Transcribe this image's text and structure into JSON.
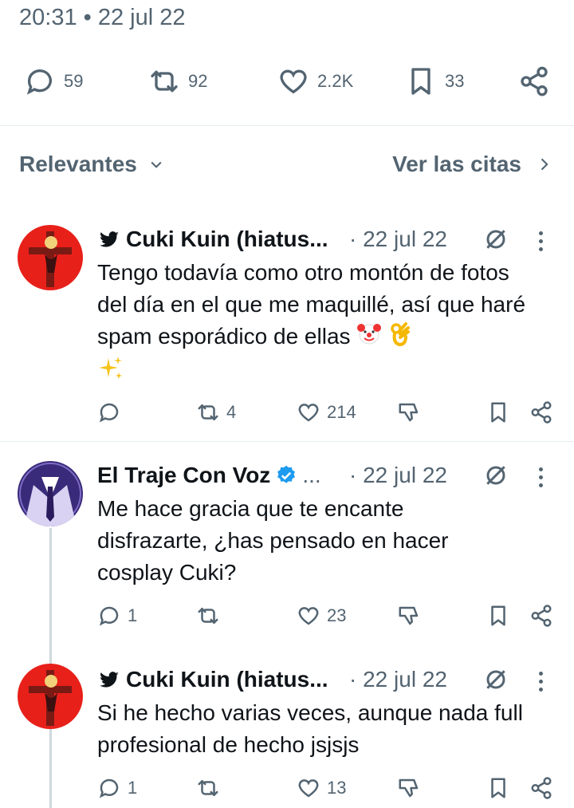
{
  "header": {
    "timestamp": "20:31 • 22 jul 22",
    "stats": {
      "replies": "59",
      "retweets": "92",
      "likes": "2.2K",
      "bookmarks": "33"
    }
  },
  "sort_bar": {
    "sort_label": "Relevantes",
    "quotes_label": "Ver las citas"
  },
  "replies": [
    {
      "author": "Cuki Kuin (hiatus...",
      "date": "· 22 jul 22",
      "text": "Tengo todavía como otro montón de fotos del día en el que me maquillé, así que haré spam esporádico de ellas",
      "replies": "",
      "retweets": "4",
      "likes": "214"
    },
    {
      "author": "El Traje Con Voz",
      "author_suffix": "...",
      "date": "· 22 jul 22",
      "text": "Me hace gracia que te encante disfrazarte, ¿has pensado en hacer cosplay Cuki?",
      "replies": "1",
      "retweets": "",
      "likes": "23"
    },
    {
      "author": "Cuki Kuin (hiatus...",
      "date": "· 22 jul 22",
      "text": "Si he hecho varias veces, aunque nada full profesional de hecho jsjsjs",
      "replies": "1",
      "retweets": "",
      "likes": "13"
    }
  ],
  "colors": {
    "text": "#0f1419",
    "secondary": "#536471",
    "divider": "#e6ecf0",
    "verified": "#1d9bf0",
    "avatar_red": "#e8201a",
    "avatar_purple": "#3a2a7a"
  }
}
